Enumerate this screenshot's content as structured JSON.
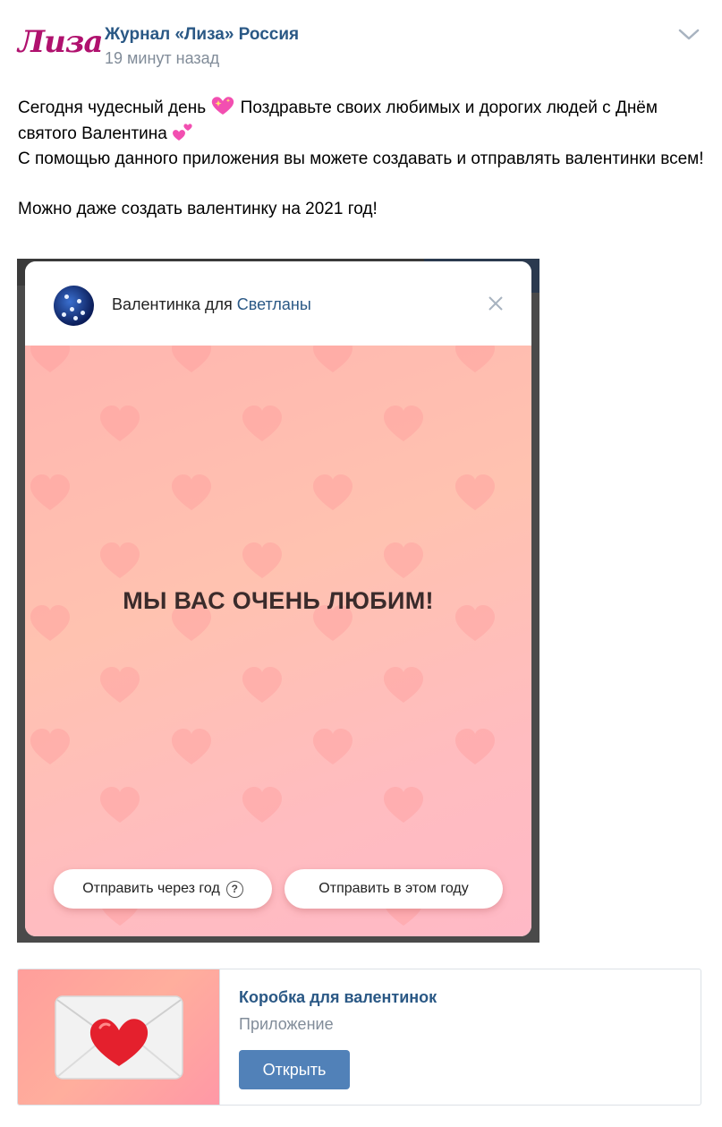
{
  "post": {
    "author": "Журнал «Лиза» Россия",
    "logo_text": "Лиза",
    "time": "19 минут назад",
    "text_line1a": "Сегодня чудесный день ",
    "text_line1b": " Поздравьте своих любимых и дорогих людей с Днём святого Валентина ",
    "text_line2": "С помощью данного приложения вы можете создавать и отправлять валентинки всем!",
    "text_line3": "Можно даже создать валентинку на 2021 год!"
  },
  "valentine": {
    "title_prefix": "Валентинка для ",
    "title_name": "Светланы",
    "message": "МЫ ВАС ОЧЕНЬ ЛЮБИМ!",
    "btn_next_year": "Отправить через год",
    "btn_next_year_help": "?",
    "btn_this_year": "Отправить в этом году"
  },
  "app": {
    "title": "Коробка для валентинок",
    "subtitle": "Приложение",
    "open_label": "Открыть"
  },
  "colors": {
    "link": "#2a5885",
    "muted": "#818c99",
    "button": "#5181b8",
    "logo": "#b0116e"
  },
  "icons": [
    "chevron-down-icon",
    "sparkling-heart-icon",
    "two-hearts-icon",
    "close-icon",
    "help-icon",
    "envelope-heart-icon"
  ]
}
